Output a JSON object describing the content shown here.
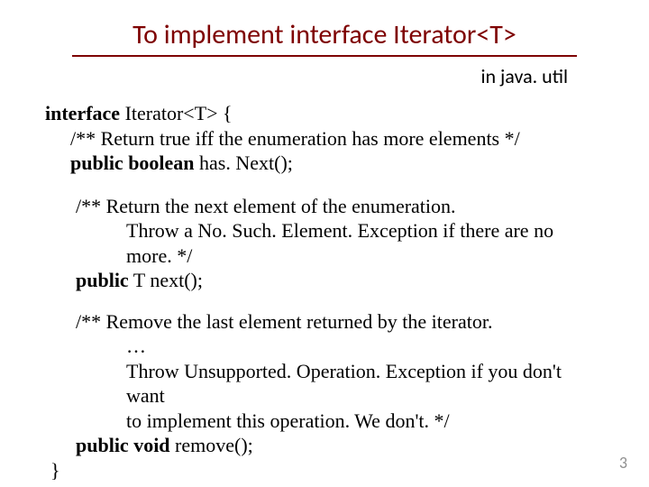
{
  "title": "To implement interface  Iterator<T>",
  "subtitle": "in java. util",
  "code": {
    "decl_pre": "interface",
    "decl_post": " Iterator<T> {",
    "b1_comment": "/** Return true iff the enumeration has more elements */",
    "b1_sig_kw": "public boolean",
    "b1_sig_rest": " has. Next();",
    "b2_c1": "/** Return the next element of the enumeration.",
    "b2_c2": "Throw a No. Such. Element. Exception if there are no more. */",
    "b2_sig_kw": "public",
    "b2_sig_rest": " T next();",
    "b3_c1": "/** Remove the last element returned by the iterator.",
    "b3_c2": "…",
    "b3_c3": "Throw Unsupported. Operation. Exception if you don't want",
    "b3_c4": "to implement this operation. We don't.  */",
    "b3_sig_kw": "public void",
    "b3_sig_rest": " remove();",
    "close": "}"
  },
  "page": "3"
}
